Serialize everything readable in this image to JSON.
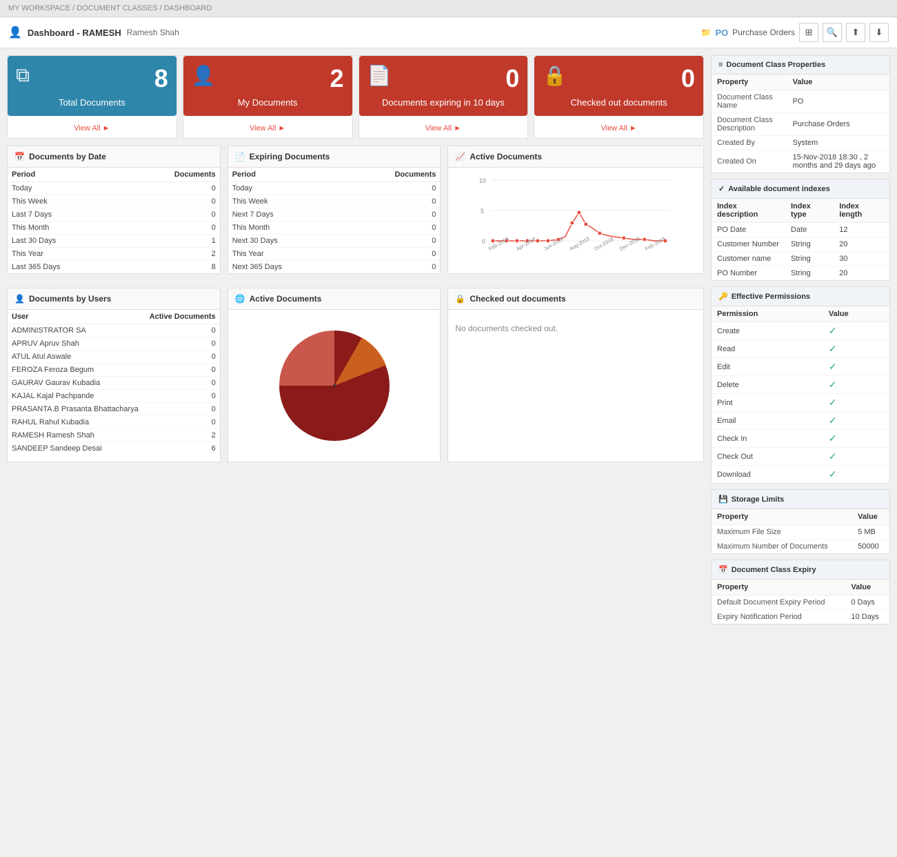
{
  "breadcrumb": {
    "items": [
      "MY WORKSPACE",
      "DOCUMENT CLASSES",
      "DASHBOARD"
    ]
  },
  "header": {
    "title": "Dashboard - RAMESH",
    "subtitle": "Ramesh Shah",
    "po_icon": "folder-icon",
    "po_label": "PO",
    "po_text": "Purchase Orders",
    "icons": [
      "grid-icon",
      "search-icon",
      "upload-icon",
      "download-icon"
    ]
  },
  "summary_cards": [
    {
      "id": "total-docs",
      "number": "8",
      "label": "Total Documents",
      "color": "blue",
      "view_all": "View All"
    },
    {
      "id": "my-docs",
      "number": "2",
      "label": "My Documents",
      "color": "red",
      "view_all": "View All"
    },
    {
      "id": "expiring-docs",
      "number": "0",
      "label": "Documents expiring in 10 days",
      "color": "red",
      "view_all": "View All"
    },
    {
      "id": "checked-out",
      "number": "0",
      "label": "Checked out documents",
      "color": "red",
      "view_all": "View All"
    }
  ],
  "documents_by_date": {
    "title": "Documents by Date",
    "headers": [
      "Period",
      "Documents"
    ],
    "rows": [
      [
        "Today",
        "0"
      ],
      [
        "This Week",
        "0"
      ],
      [
        "Last 7 Days",
        "0"
      ],
      [
        "This Month",
        "0"
      ],
      [
        "Last 30 Days",
        "1"
      ],
      [
        "This Year",
        "2"
      ],
      [
        "Last 365 Days",
        "8"
      ]
    ]
  },
  "expiring_documents": {
    "title": "Expiring Documents",
    "headers": [
      "Period",
      "Documents"
    ],
    "rows": [
      [
        "Today",
        "0"
      ],
      [
        "This Week",
        "0"
      ],
      [
        "Next 7 Days",
        "0"
      ],
      [
        "This Month",
        "0"
      ],
      [
        "Next 30 Days",
        "0"
      ],
      [
        "This Year",
        "0"
      ],
      [
        "Next 365 Days",
        "0"
      ]
    ]
  },
  "active_documents_chart": {
    "title": "Active Documents",
    "y_max": "10",
    "y_mid": "5",
    "y_min": "0",
    "labels": [
      "Feb-2018",
      "Apr-2018",
      "Jun-2018",
      "Aug-2018",
      "Oct-2018",
      "Dec-2018",
      "Feb-2019"
    ]
  },
  "documents_by_users": {
    "title": "Documents by Users",
    "headers": [
      "User",
      "Active Documents"
    ],
    "rows": [
      [
        "ADMINISTRATOR SA",
        "0"
      ],
      [
        "APRUV Apruv Shah",
        "0"
      ],
      [
        "ATUL Atul Aswale",
        "0"
      ],
      [
        "FEROZA Feroza Begum",
        "0"
      ],
      [
        "GAURAV Gaurav Kubadia",
        "0"
      ],
      [
        "KAJAL Kajal Pachpande",
        "0"
      ],
      [
        "PRASANTA.B Prasanta Bhattacharya",
        "0"
      ],
      [
        "RAHUL Rahul Kubadia",
        "0"
      ],
      [
        "RAMESH Ramesh Shah",
        "2"
      ],
      [
        "SANDEEP Sandeep Desai",
        "6"
      ]
    ]
  },
  "active_documents_pie": {
    "title": "Active Documents"
  },
  "checked_out_section": {
    "title": "Checked out documents",
    "no_docs_message": "No documents checked out."
  },
  "doc_class_properties": {
    "title": "Document Class Properties",
    "rows": [
      [
        "Document Class Name",
        "PO"
      ],
      [
        "Document Class Description",
        "Purchase Orders"
      ],
      [
        "Created By",
        "System"
      ],
      [
        "Created On",
        "15-Nov-2018 18:30 , 2 months and 29 days ago"
      ]
    ]
  },
  "available_indexes": {
    "title": "Available document indexes",
    "headers": [
      "Index description",
      "Index type",
      "Index length"
    ],
    "rows": [
      [
        "PO Date",
        "Date",
        "12"
      ],
      [
        "Customer Number",
        "String",
        "20"
      ],
      [
        "Customer name",
        "String",
        "30"
      ],
      [
        "PO Number",
        "String",
        "20"
      ]
    ]
  },
  "effective_permissions": {
    "title": "Effective Permissions",
    "headers": [
      "Permission",
      "Value"
    ],
    "rows": [
      [
        "Create",
        true
      ],
      [
        "Read",
        true
      ],
      [
        "Edit",
        true
      ],
      [
        "Delete",
        true
      ],
      [
        "Print",
        true
      ],
      [
        "Email",
        true
      ],
      [
        "Check In",
        true
      ],
      [
        "Check Out",
        true
      ],
      [
        "Download",
        true
      ]
    ]
  },
  "storage_limits": {
    "title": "Storage Limits",
    "headers": [
      "Property",
      "Value"
    ],
    "rows": [
      [
        "Maximum File Size",
        "5 MB"
      ],
      [
        "Maximum Number of Documents",
        "50000"
      ]
    ]
  },
  "doc_class_expiry": {
    "title": "Document Class Expiry",
    "headers": [
      "Property",
      "Value"
    ],
    "rows": [
      [
        "Default Document Expiry Period",
        "0 Days"
      ],
      [
        "Expiry Notification Period",
        "10 Days"
      ]
    ]
  }
}
